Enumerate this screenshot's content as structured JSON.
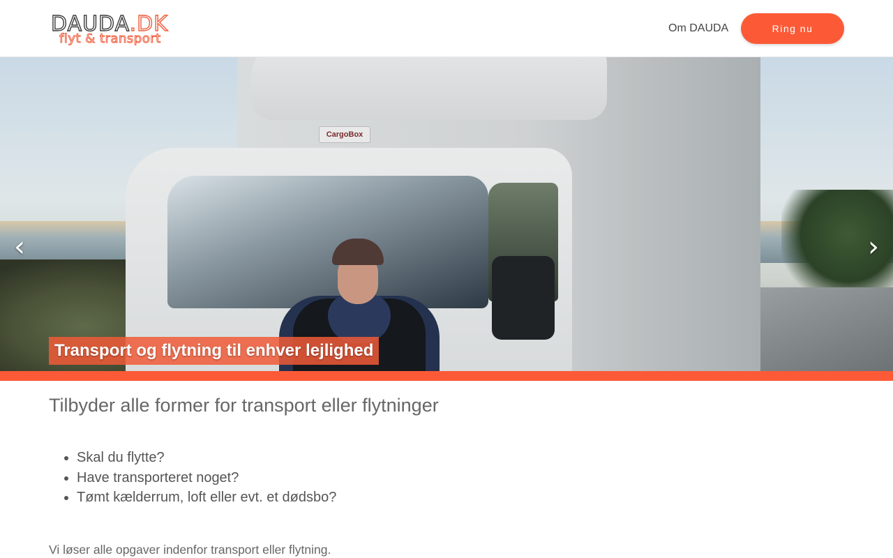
{
  "header": {
    "logo_main": "DAUDA",
    "logo_tld": ".DK",
    "logo_tagline": "flyt & transport",
    "nav_link": "Om DAUDA",
    "cta_label": "Ring nu"
  },
  "hero": {
    "truck_badge": "CargoBox",
    "caption": "Transport og flytning til enhver lejlighed",
    "prev_glyph": "‹",
    "next_glyph": "›"
  },
  "content": {
    "headline": "Tilbyder alle former for transport eller flytninger",
    "bullets": [
      "Skal du flytte?",
      "Have transporteret noget?",
      "Tømt kælderrum, loft eller evt. et dødsbo?"
    ],
    "paragraph": "Vi løser alle opgaver indenfor transport eller flytning."
  },
  "colors": {
    "accent": "#fc5a37",
    "text": "#555555"
  },
  "icons": {
    "prev": "chevron-left-icon",
    "next": "chevron-right-icon"
  }
}
